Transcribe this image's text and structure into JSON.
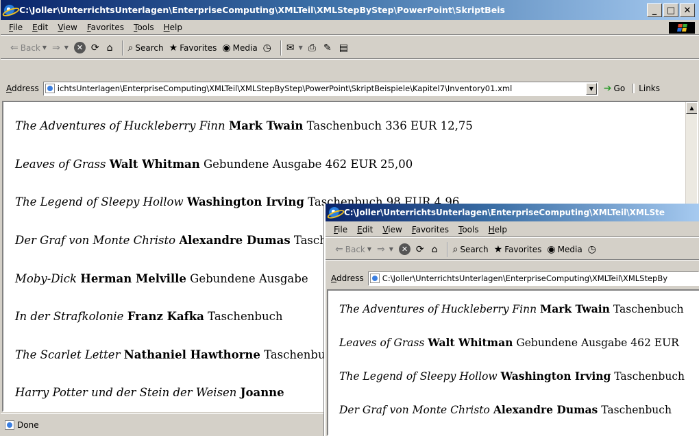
{
  "main_window": {
    "title": "C:\\Joller\\UnterrichtsUnterlagen\\EnterpriseComputing\\XMLTeil\\XMLStepByStep\\PowerPoint\\SkriptBeis",
    "menu": [
      "File",
      "Edit",
      "View",
      "Favorites",
      "Tools",
      "Help"
    ],
    "toolbar": {
      "back": "Back",
      "search": "Search",
      "favorites": "Favorites",
      "media": "Media"
    },
    "address_label": "Address",
    "address_value": "ichtsUnterlagen\\EnterpriseComputing\\XMLTeil\\XMLStepByStep\\PowerPoint\\SkriptBeispiele\\Kapitel7\\Inventory01.xml",
    "go_label": "Go",
    "links_label": "Links",
    "books": [
      {
        "title": "The Adventures of Huckleberry Finn",
        "author": "Mark Twain",
        "details": "Taschenbuch 336 EUR 12,75"
      },
      {
        "title": "Leaves of Grass",
        "author": "Walt Whitman",
        "details": "Gebundene Ausgabe 462 EUR 25,00"
      },
      {
        "title": "The Legend of Sleepy Hollow",
        "author": "Washington Irving",
        "details": "Taschenbuch 98 EUR 4,96"
      },
      {
        "title": "Der Graf von Monte Christo",
        "author": "Alexandre Dumas",
        "details": "Taschenbuch"
      },
      {
        "title": "Moby-Dick",
        "author": "Herman Melville",
        "details": "Gebundene Ausgabe"
      },
      {
        "title": "In der Strafkolonie",
        "author": "Franz Kafka",
        "details": "Taschenbuch"
      },
      {
        "title": "The Scarlet Letter",
        "author": "Nathaniel Hawthorne",
        "details": "Taschenbuch"
      },
      {
        "title": "Harry Potter und der Stein der Weisen",
        "author": "Joanne",
        "details": ""
      }
    ],
    "status": "Done"
  },
  "second_window": {
    "title": "C:\\Joller\\UnterrichtsUnterlagen\\EnterpriseComputing\\XMLTeil\\XMLSte",
    "menu": [
      "File",
      "Edit",
      "View",
      "Favorites",
      "Tools",
      "Help"
    ],
    "toolbar": {
      "back": "Back",
      "search": "Search",
      "favorites": "Favorites",
      "media": "Media"
    },
    "address_label": "Address",
    "address_value": "C:\\Joller\\UnterrichtsUnterlagen\\EnterpriseComputing\\XMLTeil\\XMLStepBy",
    "books": [
      {
        "title": "The Adventures of Huckleberry Finn",
        "author": "Mark Twain",
        "details": "Taschenbuch"
      },
      {
        "title": "Leaves of Grass",
        "author": "Walt Whitman",
        "details": "Gebundene Ausgabe 462 EUR"
      },
      {
        "title": "The Legend of Sleepy Hollow",
        "author": "Washington Irving",
        "details": "Taschenbuch"
      },
      {
        "title": "Der Graf von Monte Christo",
        "author": "Alexandre Dumas",
        "details": "Taschenbuch"
      }
    ]
  }
}
